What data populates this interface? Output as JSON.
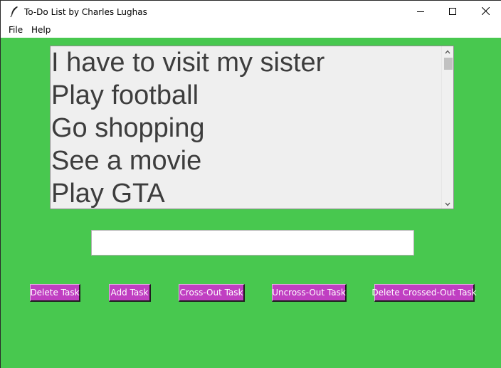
{
  "window": {
    "title": "To-Do List by Charles Lughas"
  },
  "menu": {
    "file": "File",
    "help": "Help"
  },
  "colors": {
    "background": "#48c84f",
    "button": "#c03fc2",
    "listbox": "#efefef",
    "list_text": "#3d3d3d"
  },
  "tasks": [
    "I have to visit my sister",
    "Play football",
    "Go shopping",
    "See a movie",
    "Play GTA"
  ],
  "entry": {
    "value": ""
  },
  "buttons": {
    "delete_task": "Delete Task",
    "add_task": "Add Task",
    "cross_out_task": "Cross-Out Task",
    "uncross_out_task": "Uncross-Out Task",
    "delete_crossed_out_task": "Delete Crossed-Out Task"
  },
  "icons": {
    "app": "feather-icon",
    "minimize": "minimize-icon",
    "maximize": "maximize-icon",
    "close": "close-icon",
    "scroll_up": "chevron-up-icon",
    "scroll_down": "chevron-down-icon"
  }
}
